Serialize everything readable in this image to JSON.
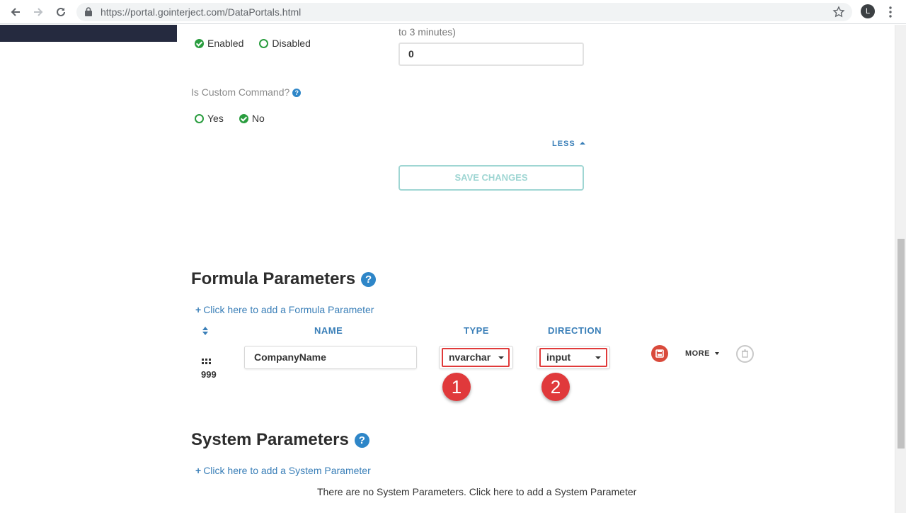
{
  "browser": {
    "url_host": "https://portal.gointerject.com",
    "url_path": "/DataPortals.html",
    "profile_initial": "L"
  },
  "settings": {
    "timeout_note": "to 3 minutes)",
    "timeout_value": "0",
    "enabled_label": "Enabled",
    "disabled_label": "Disabled",
    "enabled_selected": "Enabled",
    "custom_command_label": "Is Custom Command?",
    "yes_label": "Yes",
    "no_label": "No",
    "custom_command_selected": "No",
    "less_label": "LESS",
    "save_changes_label": "SAVE CHANGES"
  },
  "formula_parameters": {
    "title": "Formula Parameters",
    "help_glyph": "?",
    "add_link": "Click here to add a Formula Parameter",
    "columns": {
      "name": "NAME",
      "type": "TYPE",
      "direction": "DIRECTION"
    },
    "rows": [
      {
        "order": "999",
        "name": "CompanyName",
        "type": "nvarchar",
        "direction": "input"
      }
    ],
    "more_label": "MORE"
  },
  "annotations": {
    "badge_1": "1",
    "badge_2": "2"
  },
  "system_parameters": {
    "title": "System Parameters",
    "help_glyph": "?",
    "add_link": "Click here to add a System Parameter",
    "empty_message": "There are no System Parameters. Click here to add a System Parameter"
  },
  "colors": {
    "accent_blue": "#3a7fb8",
    "radio_green": "#2a9d3f",
    "annotation_red": "#e0393b",
    "save_button_teal": "#9fd6d3",
    "sidebar_navy": "#252a3f"
  }
}
